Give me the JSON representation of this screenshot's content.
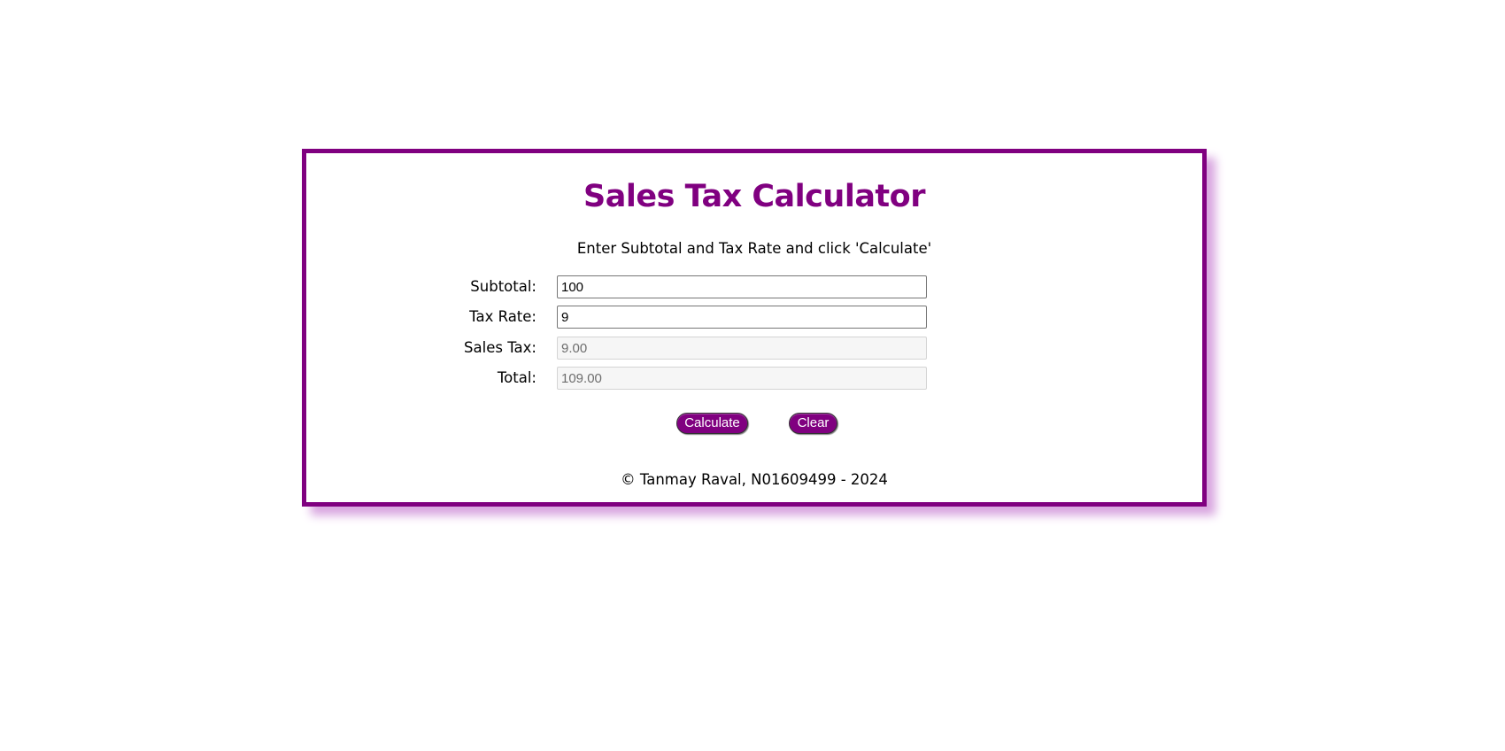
{
  "calculator": {
    "title": "Sales Tax Calculator",
    "instructions": "Enter Subtotal and Tax Rate and click 'Calculate'",
    "fields": {
      "subtotal": {
        "label": "Subtotal:",
        "value": "100"
      },
      "tax_rate": {
        "label": "Tax Rate:",
        "value": "9"
      },
      "sales_tax": {
        "label": "Sales Tax:",
        "value": "9.00"
      },
      "total": {
        "label": "Total:",
        "value": "109.00"
      }
    },
    "buttons": {
      "calculate_label": "Calculate",
      "clear_label": "Clear"
    },
    "footer": "© Tanmay Raval, N01609499 - 2024"
  },
  "colors": {
    "accent": "#800080",
    "shadow": "#d9a6e0"
  }
}
